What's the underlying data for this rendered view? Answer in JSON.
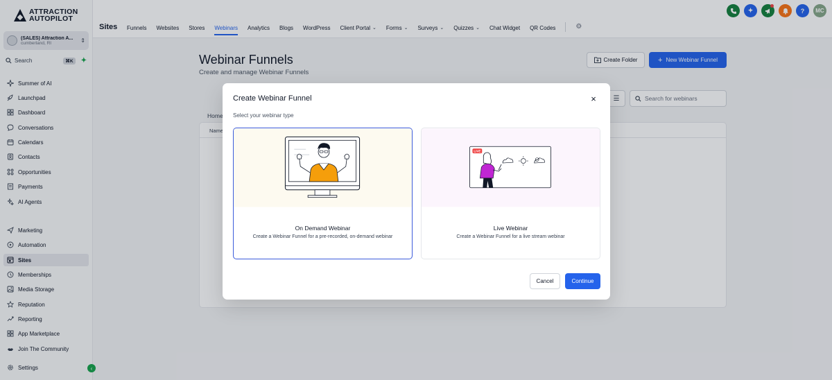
{
  "brand": {
    "line1": "ATTRACTION",
    "line2": "AUTOPILOT"
  },
  "account": {
    "name": "(SALES) Attraction A...",
    "location": "cumberland, RI"
  },
  "sidebar": {
    "search_label": "Search",
    "search_shortcut": "⌘K",
    "items": [
      {
        "label": "Summer of AI",
        "icon": "sparkle-icon"
      },
      {
        "label": "Launchpad",
        "icon": "rocket-icon"
      },
      {
        "label": "Dashboard",
        "icon": "dashboard-icon"
      },
      {
        "label": "Conversations",
        "icon": "chat-icon"
      },
      {
        "label": "Calendars",
        "icon": "calendar-icon"
      },
      {
        "label": "Contacts",
        "icon": "contacts-icon"
      },
      {
        "label": "Opportunities",
        "icon": "opportunities-icon"
      },
      {
        "label": "Payments",
        "icon": "payments-icon"
      },
      {
        "label": "AI Agents",
        "icon": "ai-agents-icon"
      },
      {
        "label": "Marketing",
        "icon": "send-icon"
      },
      {
        "label": "Automation",
        "icon": "automation-icon"
      },
      {
        "label": "Sites",
        "icon": "sites-icon"
      },
      {
        "label": "Memberships",
        "icon": "memberships-icon"
      },
      {
        "label": "Media Storage",
        "icon": "media-icon"
      },
      {
        "label": "Reputation",
        "icon": "star-icon"
      },
      {
        "label": "Reporting",
        "icon": "reporting-icon"
      },
      {
        "label": "App Marketplace",
        "icon": "marketplace-icon"
      },
      {
        "label": "Join The Community",
        "icon": "community-icon"
      },
      {
        "label": "Settings",
        "icon": "gear-icon"
      }
    ]
  },
  "topbar": {
    "title": "Sites",
    "tabs": [
      {
        "label": "Funnels"
      },
      {
        "label": "Websites"
      },
      {
        "label": "Stores"
      },
      {
        "label": "Webinars",
        "active": true
      },
      {
        "label": "Analytics"
      },
      {
        "label": "Blogs"
      },
      {
        "label": "WordPress"
      },
      {
        "label": "Client Portal",
        "dropdown": true
      },
      {
        "label": "Forms",
        "dropdown": true
      },
      {
        "label": "Surveys",
        "dropdown": true
      },
      {
        "label": "Quizzes",
        "dropdown": true
      },
      {
        "label": "Chat Widget"
      },
      {
        "label": "QR Codes"
      }
    ],
    "avatar_initials": "MC",
    "help_label": "?",
    "icon_colors": [
      "#15803d",
      "#2563eb",
      "#15803d",
      "#f97316",
      "#2563eb",
      "#86a789"
    ]
  },
  "main": {
    "title": "Webinar Funnels",
    "subtitle": "Create and manage Webinar Funnels",
    "create_folder_label": "Create Folder",
    "new_funnel_label": "New Webinar Funnel",
    "search_placeholder": "Search for webinars",
    "breadcrumb": "Home",
    "table_header_name": "Name"
  },
  "modal": {
    "title": "Create Webinar Funnel",
    "subtitle": "Select your webinar type",
    "options": [
      {
        "title": "On Demand Webinar",
        "description": "Create a Webinar Funnel for a pre-recorded, on-demand webinar",
        "selected": true
      },
      {
        "title": "Live Webinar",
        "description": "Create a Webinar Funnel for a live stream webinar",
        "selected": false,
        "badge": "LIVE"
      }
    ],
    "cancel_label": "Cancel",
    "continue_label": "Continue"
  }
}
